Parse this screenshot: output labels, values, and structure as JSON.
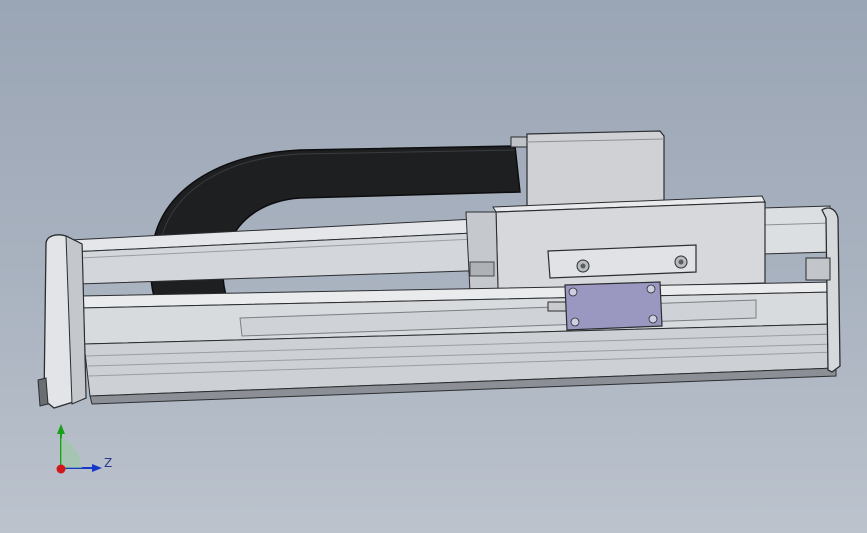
{
  "viewport": {
    "background_top": "#9aa5b5",
    "background_bottom": "#bcc3cd"
  },
  "model": {
    "colors": {
      "rail_light": "#e4e6e9",
      "rail_mid": "#c9ccd1",
      "rail_dark": "#8c9096",
      "outline": "#2b2d30",
      "cable_chain": "#1e1f21",
      "motor_block": "#cfd1d4",
      "carriage": "#d6d8db",
      "sensor_plate": "#9a98c0",
      "screw": "#5a5d62"
    }
  },
  "triad": {
    "axis_z_label": "Z",
    "colors": {
      "x": "#d01818",
      "y": "#18a018",
      "z": "#1838c8"
    }
  }
}
